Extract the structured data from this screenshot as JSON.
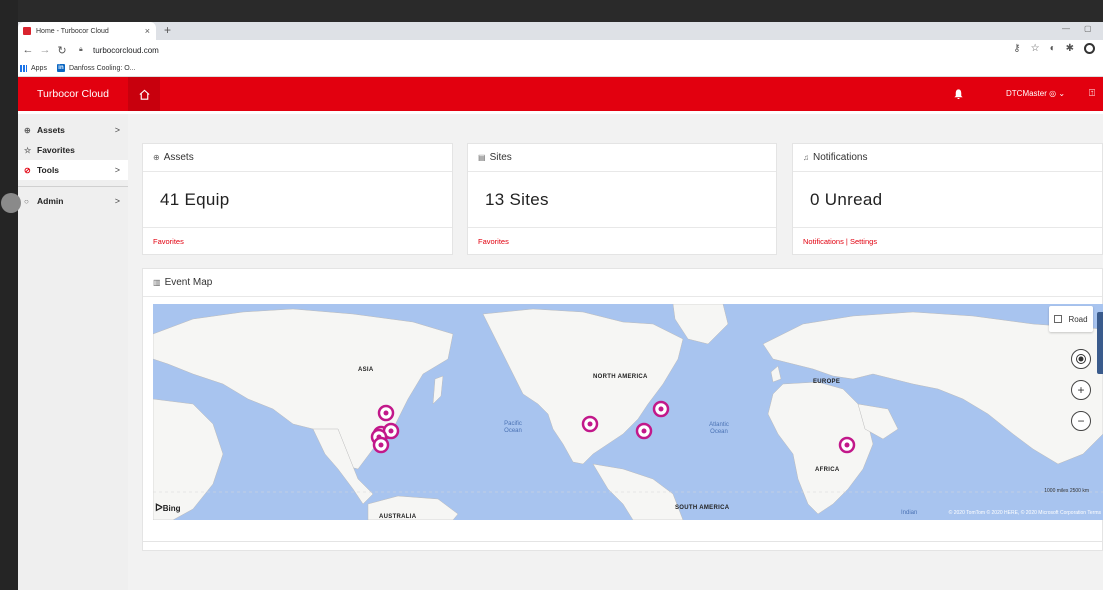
{
  "browser": {
    "tab_title": "Home - Turbocor Cloud",
    "tab_close": "×",
    "new_tab": "+",
    "url": "turbocorcloud.com",
    "bookmarks": [
      {
        "label": "Apps"
      },
      {
        "label": "Danfoss Cooling: O..."
      }
    ]
  },
  "header": {
    "brand": "Turbocor Cloud",
    "user": "DTCMaster ◎ ⌄"
  },
  "sidebar": {
    "items": [
      {
        "icon": "⊕",
        "label": "Assets",
        "chevron": ">"
      },
      {
        "icon": "☆",
        "label": "Favorites",
        "chevron": ""
      },
      {
        "icon": "⊘",
        "label": "Tools",
        "chevron": ">"
      },
      {
        "icon": "○",
        "label": "Admin",
        "chevron": ">"
      }
    ]
  },
  "cards": {
    "assets": {
      "title": "Assets",
      "value": "41 Equip",
      "link": "Favorites"
    },
    "sites": {
      "title": "Sites",
      "value": "13 Sites",
      "link": "Favorites"
    },
    "notifications": {
      "title": "Notifications",
      "value": "0 Unread",
      "link": "Notifications | Settings"
    }
  },
  "event_map": {
    "title": "Event Map",
    "road_label": "Road",
    "labels": {
      "asia": "ASIA",
      "north_america": "NORTH AMERICA",
      "europe": "EUROPE",
      "africa": "AFRICA",
      "south_america": "SOUTH AMERICA",
      "australia": "AUSTRALIA"
    },
    "oceans": {
      "pacific": "Pacific Ocean",
      "atlantic": "Atlantic Ocean",
      "indian": "Indian"
    },
    "bing": "Bing",
    "copyright": "© 2020 TomTom © 2020 HERE, © 2020 Microsoft Corporation Terms",
    "scale": "1000 miles     2500 km",
    "markers_count": 8,
    "colors": {
      "marker": "#c2188a",
      "land": "#f6f6f4",
      "water": "#a8c4ef"
    }
  },
  "theme": {
    "accent": "#e2000f"
  }
}
